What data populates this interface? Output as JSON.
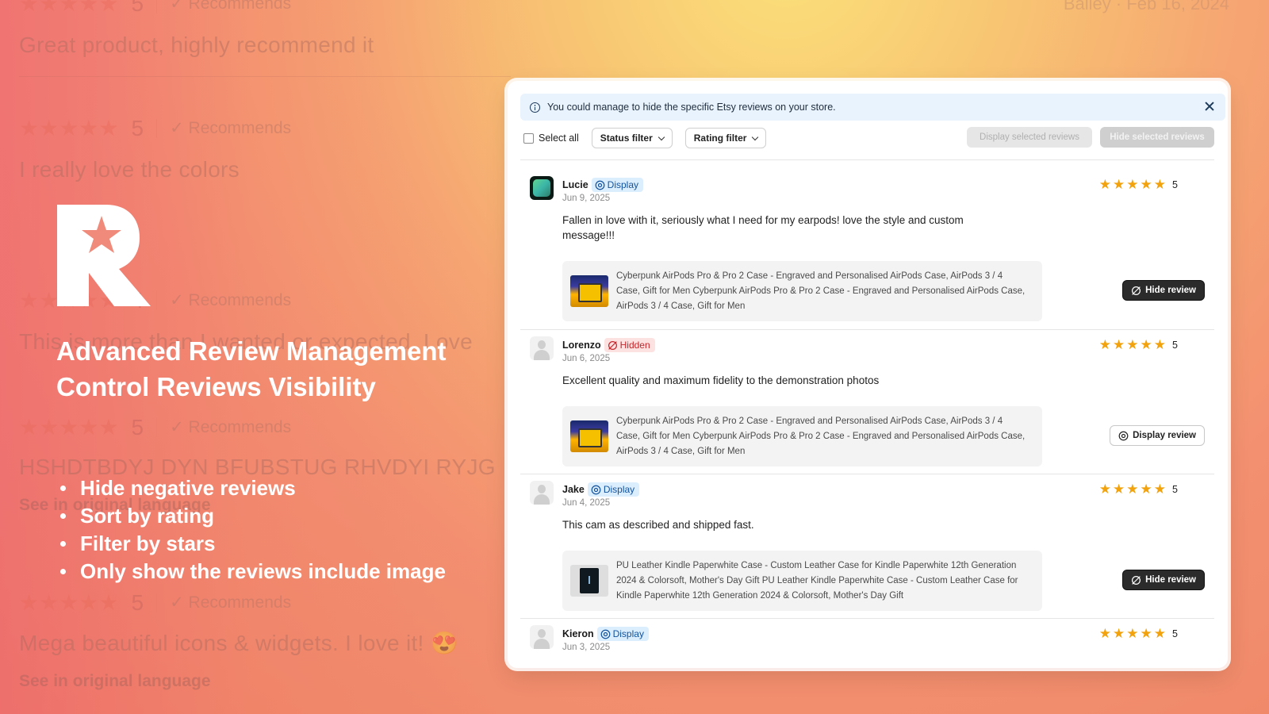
{
  "background": {
    "top_right": "Bailey · Feb 16, 2024",
    "reviews": [
      {
        "rating": "5",
        "recommends": "✓ Recommends",
        "text": "Great product, highly recommend it"
      },
      {
        "rating": "5",
        "recommends": "✓ Recommends",
        "text": "I really love the colors"
      },
      {
        "rating": "4",
        "recommends": "✓ Recommends",
        "text": "This is more than I wanted or expected. Love"
      },
      {
        "rating": "5",
        "recommends": "✓ Recommends",
        "text": "HSHDTBDYJ DYN BFUBSTUG RHVDYI RYJG",
        "link": "See in original language"
      },
      {
        "rating": "5",
        "recommends": "✓ Recommends",
        "text": "Mega beautiful icons & widgets. I love it! 😍",
        "link": "See in original language"
      }
    ]
  },
  "hero": {
    "title_line1": "Advanced Review Management",
    "title_line2": "Control Reviews Visibility",
    "features": [
      "Hide negative reviews",
      "Sort by rating",
      "Filter by stars",
      "Only show the reviews include image"
    ]
  },
  "panel": {
    "banner": "You could manage to hide the specific Etsy reviews on your store.",
    "toolbar": {
      "select_all": "Select all",
      "status_filter": "Status filter",
      "rating_filter": "Rating filter",
      "display_selected": "Display selected reviews",
      "hide_selected": "Hide selected reviews"
    },
    "reviews": [
      {
        "name": "Lucie",
        "status": "Display",
        "date": "Jun 9, 2025",
        "rating": "5",
        "text": "Fallen in love with it, seriously what I need for my earpods! love the style and custom message!!!",
        "product": "Cyberpunk AirPods Pro & Pro 2 Case - Engraved and Personalised AirPods Case, AirPods 3 / 4 Case, Gift for Men Cyberpunk AirPods Pro & Pro 2 Case - Engraved and Personalised AirPods Case, AirPods 3 / 4 Case, Gift for Men",
        "action": "Hide review"
      },
      {
        "name": "Lorenzo",
        "status": "Hidden",
        "date": "Jun 6, 2025",
        "rating": "5",
        "text": "Excellent quality and maximum fidelity to the demonstration photos",
        "product": "Cyberpunk AirPods Pro & Pro 2 Case - Engraved and Personalised AirPods Case, AirPods 3 / 4 Case, Gift for Men Cyberpunk AirPods Pro & Pro 2 Case - Engraved and Personalised AirPods Case, AirPods 3 / 4 Case, Gift for Men",
        "action": "Display review"
      },
      {
        "name": "Jake",
        "status": "Display",
        "date": "Jun 4, 2025",
        "rating": "5",
        "text": "This cam as described and shipped fast.",
        "product": "PU Leather Kindle Paperwhite Case - Custom Leather Case for Kindle Paperwhite 12th Generation 2024 & Colorsoft, Mother's Day Gift PU Leather Kindle Paperwhite Case - Custom Leather Case for Kindle Paperwhite 12th Generation 2024 & Colorsoft, Mother's Day Gift",
        "action": "Hide review"
      },
      {
        "name": "Kieron",
        "status": "Display",
        "date": "Jun 3, 2025",
        "rating": "5"
      }
    ]
  },
  "colors": {
    "star": "#f2a20c",
    "display_badge": "#dbeefe",
    "hidden_badge": "#fde2e2",
    "dark_button": "#2b2b2b"
  }
}
